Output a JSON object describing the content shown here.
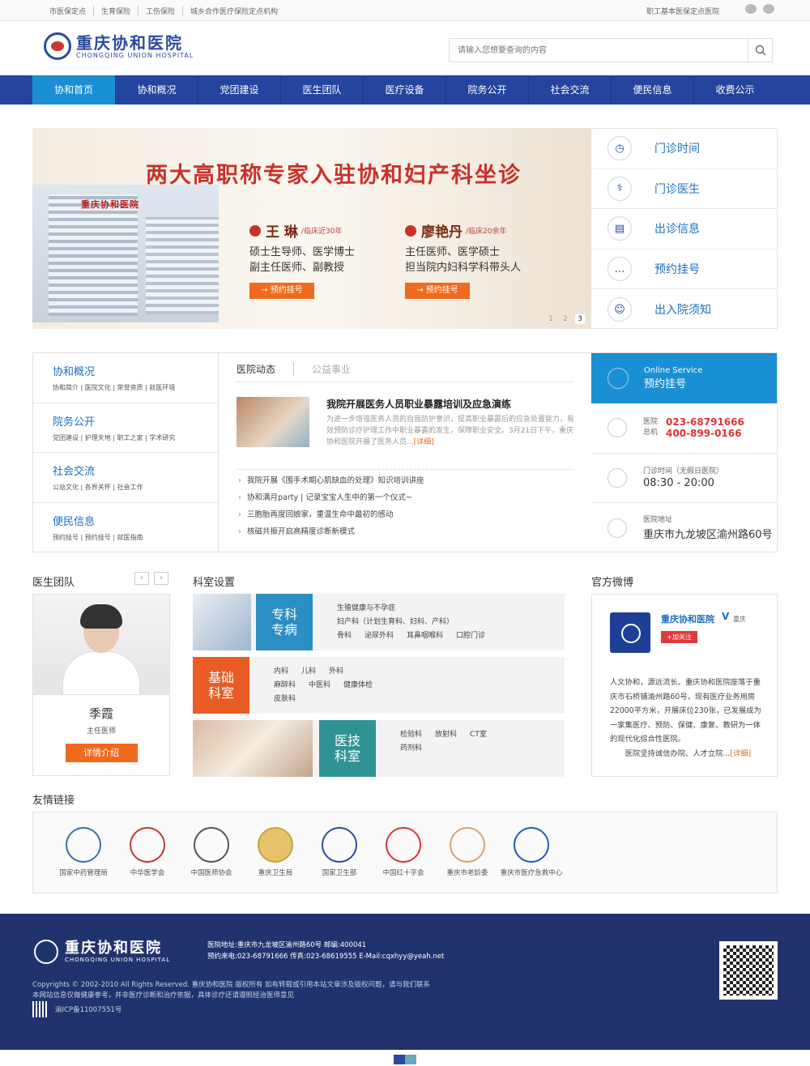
{
  "topbar": {
    "links": [
      "市医保定点",
      "生育保险",
      "工伤保险",
      "城乡合作医疗保险定点机构"
    ],
    "right_text": "职工基本医保定点医院"
  },
  "logo": {
    "cn": "重庆协和医院",
    "en": "CHONGQING UNION HOSPITAL"
  },
  "search": {
    "placeholder": "请输入您想要查询的内容"
  },
  "nav": [
    {
      "label": "协和首页",
      "active": true
    },
    {
      "label": "协和概况"
    },
    {
      "label": "党团建设"
    },
    {
      "label": "医生团队"
    },
    {
      "label": "医疗设备"
    },
    {
      "label": "院务公开"
    },
    {
      "label": "社会交流"
    },
    {
      "label": "便民信息"
    },
    {
      "label": "收费公示"
    }
  ],
  "hero": {
    "title": "两大高职称专家入驻协和妇产科坐诊",
    "building_sign": "重庆协和医院",
    "doctors": [
      {
        "name": "王 琳",
        "exp": "/临床近30年",
        "desc1": "硕士生导师、医学博士",
        "desc2": "副主任医师、副教授",
        "btn": "→ 预约挂号"
      },
      {
        "name": "廖艳丹",
        "exp": "/临床20余年",
        "desc1": "主任医师、医学硕士",
        "desc2": "担当院内妇科学科带头人",
        "btn": "→ 预约挂号"
      }
    ],
    "pages": [
      "1",
      "2",
      "3"
    ]
  },
  "quick": [
    {
      "label": "门诊时间",
      "icon": "clock-icon",
      "glyph": "◷"
    },
    {
      "label": "门诊医生",
      "icon": "stethoscope-icon",
      "glyph": "⚕"
    },
    {
      "label": "出诊信息",
      "icon": "clipboard-icon",
      "glyph": "▤"
    },
    {
      "label": "预约挂号",
      "icon": "chat-icon",
      "glyph": "…"
    },
    {
      "label": "出入院须知",
      "icon": "nurse-icon",
      "glyph": "☺"
    }
  ],
  "side": [
    {
      "title": "协和概况",
      "sub": "协和简介  |  医院文化  |  荣誉资质  |  就医环境"
    },
    {
      "title": "院务公开",
      "sub": "党团建设  |  护理天地  |  职工之家  |  学术研究"
    },
    {
      "title": "社会交流",
      "sub": "公益文化  |  各界关怀  |  社会工作"
    },
    {
      "title": "便民信息",
      "sub": "预约挂号  |  预约挂号  |  就医指南"
    }
  ],
  "news": {
    "tab1": "医院动态",
    "tab2": "公益事业",
    "headline": "我院开展医务人员职业暴露培训及应急演练",
    "summary": "为进一步增强医务人员的自我防护意识，提高职业暴露后的应急处置能力，有效预防诊疗护理工作中职业暴露的发生，保障职业安全。3月21日下午，重庆协和医院开展了医务人员...",
    "more": "[详细]",
    "items": [
      "我院开展《围手术期心肌缺血的处理》知识培训讲座",
      "协和满月party | 记录宝宝人生中的第一个仪式~",
      "三胞胎再度回娘家，重温生命中最初的感动",
      "核磁共振开启高精度诊断新模式"
    ]
  },
  "online": {
    "en": "Online Service",
    "cn": "预约挂号",
    "phone_label1": "医院",
    "phone_label2": "总机",
    "phone1": "023-68791666",
    "phone2": "400-899-0166",
    "hours_label": "门诊时间（无假日医院）",
    "hours": "08:30 - 20:00",
    "addr_label": "医院地址",
    "addr": "重庆市九龙坡区渝州路60号"
  },
  "doctor_team": {
    "title": "医生团队",
    "prev": "‹",
    "next": "›",
    "name": "季霞",
    "role": "主任医师",
    "btn": "详情介绍"
  },
  "dept": {
    "title": "科室设置",
    "rows": [
      {
        "tag": "专科\n专病",
        "color": "#2b8fc4",
        "lines": [
          "生殖健康与不孕症",
          "妇产科（计划生育科、妇科、产科）"
        ],
        "chips": [
          "骨科",
          "泌尿外科",
          "耳鼻咽喉科",
          "口腔门诊"
        ]
      },
      {
        "tag": "基础\n科室",
        "color": "#e95c25",
        "lines": [],
        "chips": [
          "内科",
          "儿科",
          "外科",
          "麻醉科",
          "中医科",
          "健康体检",
          "皮肤科"
        ]
      },
      {
        "tag": "医技\n科室",
        "color": "#2f9394",
        "lines": [],
        "chips": [
          "检验科",
          "放射科",
          "CT室",
          "药剂科"
        ]
      }
    ]
  },
  "weibo": {
    "title": "官方微博",
    "name": "重庆协和医院",
    "v": "V",
    "loc": "重庆",
    "follow": "+加关注",
    "desc": "人文协和，源远流长。重庆协和医院座落于重庆市石桥铺渝州路60号，现有医疗业务用房22000平方米，开展床位230张，已发展成为一家集医疗、预防、保健、康复、教研为一体的现代化综合性医院。",
    "desc2": "医院坚持诚信办院、人才立院...",
    "more": "[详细]"
  },
  "friends": {
    "title": "友情链接",
    "items": [
      "国家中药管理局",
      "中华医学会",
      "中国医师协会",
      "重庆卫生局",
      "国家卫生部",
      "中国红十字会",
      "重庆市老龄委",
      "重庆市医疗急救中心"
    ]
  },
  "footer": {
    "cn": "重庆协和医院",
    "en": "CHONGQING UNION HOSPITAL",
    "addr1": "医院地址:重庆市九龙坡区渝州路60号  邮编:400041",
    "addr2": "预约来电:023-68791666  传真:023-68619555  E-Mail:cqxhyy@yeah.net",
    "copy1": "Copyrights © 2002-2010 All Rights Reserved. 重庆协和医院 版权所有 如有转载或引用本站文章涉及版权问题，请与我们联系",
    "copy2": "本网站信息仅做健康参考，并非医疗诊断和治疗依据，具体诊疗还请遵照经治医师意见",
    "icp": "渝ICP备11007551号"
  }
}
